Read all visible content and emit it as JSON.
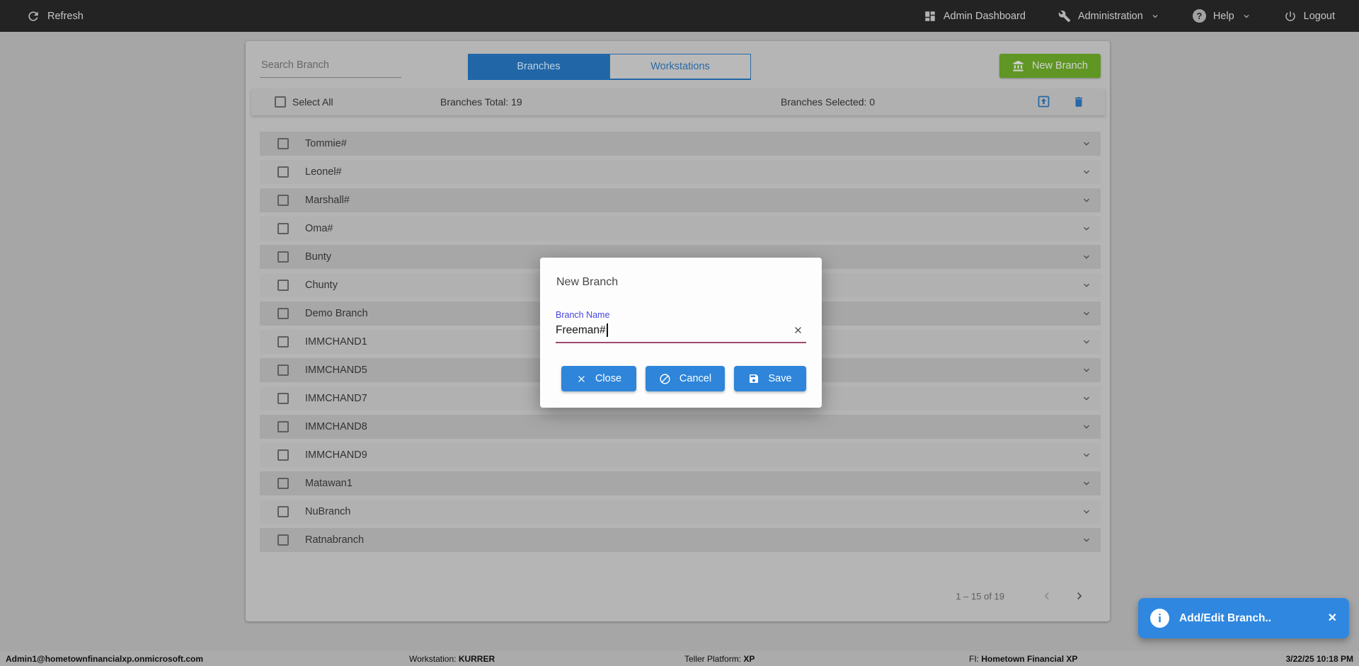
{
  "topbar": {
    "refresh": "Refresh",
    "admin_dashboard": "Admin Dashboard",
    "administration": "Administration",
    "help": "Help",
    "logout": "Logout"
  },
  "toolbar": {
    "search_placeholder": "Search Branch",
    "tab_branches": "Branches",
    "tab_workstations": "Workstations",
    "new_branch": "New Branch"
  },
  "list_header": {
    "select_all": "Select All",
    "total": "Branches Total: 19",
    "selected": "Branches Selected: 0"
  },
  "branches": [
    "Tommie#",
    "Leonel#",
    "Marshall#",
    "Oma#",
    "Bunty",
    "Chunty",
    "Demo Branch",
    "IMMCHAND1",
    "IMMCHAND5",
    "IMMCHAND7",
    "IMMCHAND8",
    "IMMCHAND9",
    "Matawan1",
    "NuBranch",
    "Ratnabranch"
  ],
  "pagination": {
    "range": "1 – 15 of 19"
  },
  "modal": {
    "title": "New Branch",
    "field_label": "Branch Name",
    "field_value": "Freeman#",
    "close": "Close",
    "cancel": "Cancel",
    "save": "Save"
  },
  "toast": {
    "message": "Add/Edit Branch..",
    "close": "✕"
  },
  "statusbar": {
    "user": "Admin1@hometownfinancialxp.onmicrosoft.com",
    "workstation_label": "Workstation: ",
    "workstation": "KURRER",
    "platform_label": "Teller Platform: ",
    "platform": "XP",
    "fi_label": "FI: ",
    "fi": "Hometown Financial XP",
    "datetime": "3/22/25 10:18 PM"
  },
  "icons": {
    "refresh": "circular-arrow",
    "admin_dashboard": "grid",
    "administration": "wrench",
    "help": "question-circle",
    "menu_expand": "chevron-down",
    "logout": "power",
    "new_branch": "bank-columns",
    "export": "box-arrow-up",
    "delete": "trash",
    "row_expand": "chevron-down",
    "page_prev": "chevron-left",
    "page_next": "chevron-right",
    "close": "x",
    "cancel": "circle-slash",
    "save": "floppy-disk",
    "input_clear": "x",
    "toast_info": "info-circle"
  },
  "colors": {
    "topbar_bg": "#232323",
    "accent_blue": "#2e85da",
    "tab_blue": "#2166a7",
    "button_green": "#5f9624",
    "field_underline": "#a04a6e",
    "label_indigo": "#4545e0",
    "toast_blue": "#2f87e0"
  }
}
